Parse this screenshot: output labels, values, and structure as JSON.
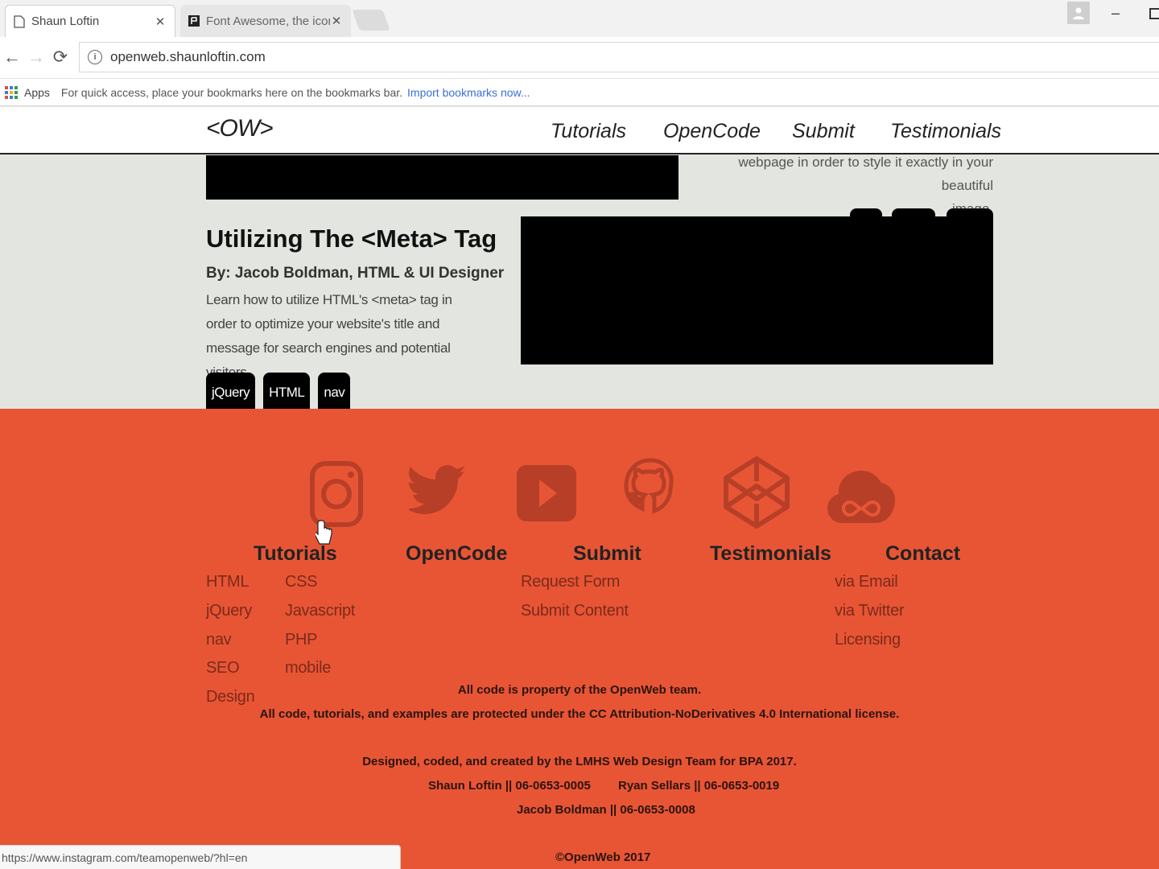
{
  "browser": {
    "tabs": [
      {
        "label": "Shaun Loftin",
        "active": true
      },
      {
        "label": "Font Awesome, the iconi",
        "active": false
      }
    ],
    "url": "openweb.shaunloftin.com",
    "bookmarks": {
      "apps_label": "Apps",
      "hint": "For quick access, place your bookmarks here on the bookmarks bar.",
      "import_link": "Import bookmarks now..."
    },
    "status_url": "https://www.instagram.com/teamopenweb/?hl=en"
  },
  "site": {
    "logo": "<OW>",
    "nav": [
      "Tutorials",
      "OpenCode",
      "Submit",
      "Testimonials"
    ]
  },
  "previous_article": {
    "text_line1": "webpage in order to style it exactly in your beautiful",
    "text_line2": "image."
  },
  "article": {
    "title": "Utilizing The <Meta> Tag",
    "byline": "By: Jacob Boldman, HTML & UI Designer",
    "description": "Learn how to utilize HTML's <meta> tag in order to optimize your website's title and message for search engines and potential visitors.",
    "tags": [
      "jQuery",
      "HTML",
      "nav"
    ]
  },
  "footer": {
    "social_icons": [
      "instagram-icon",
      "twitter-icon",
      "youtube-icon",
      "github-icon",
      "codepen-icon",
      "creative-cloud-icon"
    ],
    "columns": {
      "tutorials": {
        "title": "Tutorials",
        "col1": [
          "HTML",
          "jQuery",
          "nav",
          "SEO",
          "Design"
        ],
        "col2": [
          "CSS",
          "Javascript",
          "PHP",
          "mobile"
        ]
      },
      "opencode": {
        "title": "OpenCode"
      },
      "submit": {
        "title": "Submit",
        "links": [
          "Request Form",
          "Submit Content"
        ]
      },
      "testimonials": {
        "title": "Testimonials"
      },
      "contact": {
        "title": "Contact",
        "links": [
          "via Email",
          "via Twitter",
          "Licensing"
        ]
      }
    },
    "legal_line1": "All code is property of the OpenWeb team.",
    "legal_line2": "All code, tutorials, and examples are protected under the CC Attribution-NoDerivatives 4.0 International license.",
    "designed_by": "Designed, coded, and created by the LMHS Web Design Team for BPA 2017.",
    "credit1": "Shaun Loftin || 06-0653-0005",
    "credit2": "Ryan Sellars || 06-0653-0019",
    "credit3": "Jacob Boldman || 06-0653-0008",
    "copyright": "©OpenWeb 2017"
  },
  "colors": {
    "footer_bg": "#e85535",
    "page_bg": "#e2e5e0",
    "icon": "#b73f27"
  }
}
